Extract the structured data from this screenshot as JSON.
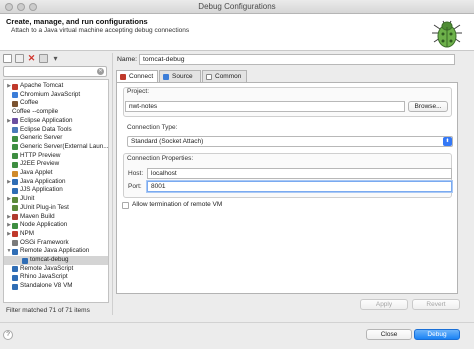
{
  "window": {
    "title": "Debug Configurations"
  },
  "header": {
    "title": "Create, manage, and run configurations",
    "subtitle": "Attach to a Java virtual machine accepting debug connections",
    "logo_icon": "bug-icon"
  },
  "toolbar": {
    "buttons": [
      "new-configuration-icon",
      "duplicate-icon",
      "delete-icon",
      "collapse-all-icon",
      "filter-icon"
    ]
  },
  "filter": {
    "value": "",
    "placeholder": ""
  },
  "tree": {
    "items": [
      {
        "label": "Apache Tomcat",
        "expandable": true,
        "indent": 0,
        "color": "#c0392b"
      },
      {
        "label": "Chromium JavaScript",
        "expandable": false,
        "indent": 0,
        "color": "#3b7dd8"
      },
      {
        "label": "Coffee",
        "expandable": false,
        "indent": 0,
        "color": "#7a5230"
      },
      {
        "label": "Coffee --compile",
        "expandable": false,
        "indent": 0,
        "color": null
      },
      {
        "label": "Eclipse Application",
        "expandable": true,
        "indent": 0,
        "color": "#6b4fa0"
      },
      {
        "label": "Eclipse Data Tools",
        "expandable": false,
        "indent": 0,
        "color": "#4a7ab8"
      },
      {
        "label": "Generic Server",
        "expandable": false,
        "indent": 0,
        "color": "#3e8e41"
      },
      {
        "label": "Generic Server(External Laun...",
        "expandable": false,
        "indent": 0,
        "color": "#3e8e41"
      },
      {
        "label": "HTTP Preview",
        "expandable": false,
        "indent": 0,
        "color": "#3e8e41"
      },
      {
        "label": "J2EE Preview",
        "expandable": false,
        "indent": 0,
        "color": "#3e8e41"
      },
      {
        "label": "Java Applet",
        "expandable": false,
        "indent": 0,
        "color": "#d08b2c"
      },
      {
        "label": "Java Application",
        "expandable": true,
        "indent": 0,
        "color": "#2f6db5"
      },
      {
        "label": "JJS Application",
        "expandable": false,
        "indent": 0,
        "color": "#2f6db5"
      },
      {
        "label": "JUnit",
        "expandable": true,
        "indent": 0,
        "color": "#5b8a3a"
      },
      {
        "label": "JUnit Plug-in Test",
        "expandable": false,
        "indent": 0,
        "color": "#5b8a3a"
      },
      {
        "label": "Maven Build",
        "expandable": true,
        "indent": 0,
        "color": "#b03a2e"
      },
      {
        "label": "Node Application",
        "expandable": true,
        "indent": 0,
        "color": "#3e8e41"
      },
      {
        "label": "NPM",
        "expandable": true,
        "indent": 0,
        "color": "#c0392b"
      },
      {
        "label": "OSGi Framework",
        "expandable": false,
        "indent": 0,
        "color": "#7b7b7b"
      },
      {
        "label": "Remote Java Application",
        "expandable": true,
        "expanded": true,
        "indent": 0,
        "color": "#2f6db5"
      },
      {
        "label": "tomcat-debug",
        "expandable": false,
        "indent": 1,
        "color": "#2f6db5",
        "selected": true
      },
      {
        "label": "Remote JavaScript",
        "expandable": false,
        "indent": 0,
        "color": "#2f6db5"
      },
      {
        "label": "Rhino JavaScript",
        "expandable": false,
        "indent": 0,
        "color": "#2f6db5"
      },
      {
        "label": "Standalone V8 VM",
        "expandable": false,
        "indent": 0,
        "color": "#2f6db5"
      }
    ]
  },
  "filter_status": "Filter matched 71 of 71 items",
  "config": {
    "name_label": "Name:",
    "name_value": "tomcat-debug",
    "tabs": [
      {
        "label": "Connect",
        "icon": "connect-icon",
        "active": true,
        "color": "#c0392b"
      },
      {
        "label": "Source",
        "icon": "source-icon",
        "active": false,
        "color": "#3b7dd8"
      },
      {
        "label": "Common",
        "icon": "common-icon",
        "active": false,
        "color": "#7b7b7b"
      }
    ],
    "project_label": "Project:",
    "project_value": "nwt-notes",
    "browse_label": "Browse...",
    "connection_type_label": "Connection Type:",
    "connection_type_value": "Standard (Socket Attach)",
    "connection_props_label": "Connection Properties:",
    "host_label": "Host:",
    "host_value": "localhost",
    "port_label": "Port:",
    "port_value": "8001",
    "allow_termination_label": "Allow termination of remote VM",
    "allow_termination_checked": false
  },
  "buttons": {
    "apply": "Apply",
    "revert": "Revert",
    "close": "Close",
    "debug": "Debug",
    "help": "?"
  }
}
